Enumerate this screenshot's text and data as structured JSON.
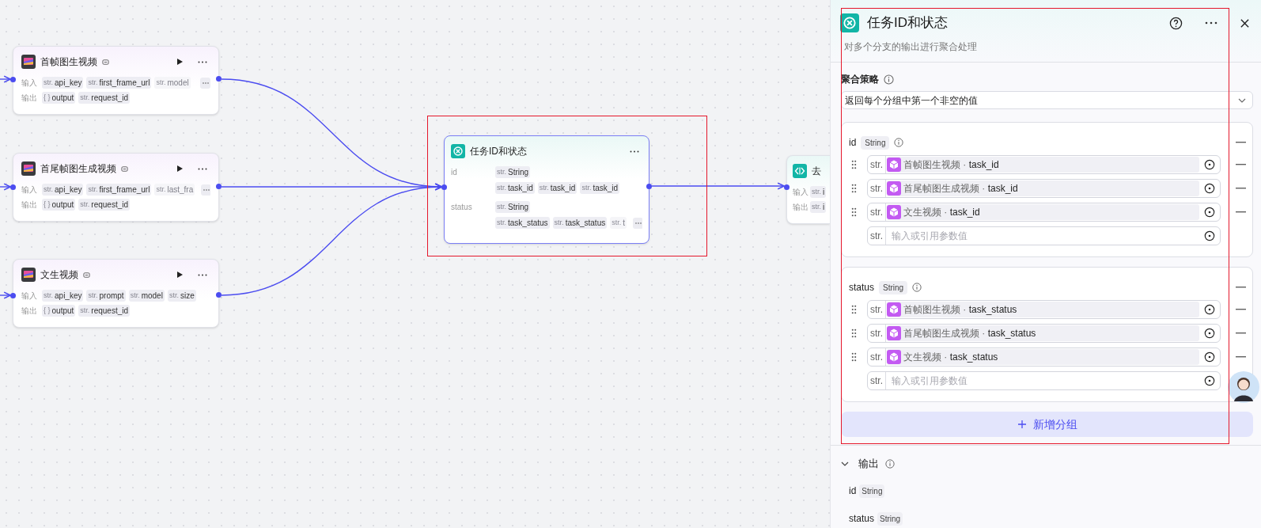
{
  "canvas": {
    "nodes": [
      {
        "kind": "video",
        "title": "首帧图生视频",
        "runnable": true,
        "rows": [
          {
            "label": "输入",
            "params": [
              {
                "type": "str.",
                "name": "api_key",
                "faded": false
              },
              {
                "type": "str.",
                "name": "first_frame_url",
                "faded": false
              },
              {
                "type": "str.",
                "name": "model",
                "faded": true
              }
            ],
            "overflow": true
          },
          {
            "label": "输出",
            "params": [
              {
                "type": "{ }",
                "name": "output",
                "faded": false
              },
              {
                "type": "str.",
                "name": "request_id",
                "faded": false
              }
            ],
            "overflow": false
          }
        ]
      },
      {
        "kind": "video",
        "title": "首尾帧图生成视频",
        "runnable": true,
        "rows": [
          {
            "label": "输入",
            "params": [
              {
                "type": "str.",
                "name": "api_key",
                "faded": false
              },
              {
                "type": "str.",
                "name": "first_frame_url",
                "faded": false
              },
              {
                "type": "str.",
                "name": "last_fra",
                "faded": true
              }
            ],
            "overflow": true
          },
          {
            "label": "输出",
            "params": [
              {
                "type": "{ }",
                "name": "output",
                "faded": false
              },
              {
                "type": "str.",
                "name": "request_id",
                "faded": false
              }
            ],
            "overflow": false
          }
        ]
      },
      {
        "kind": "video",
        "title": "文生视频",
        "runnable": true,
        "rows": [
          {
            "label": "输入",
            "params": [
              {
                "type": "str.",
                "name": "api_key",
                "faded": false
              },
              {
                "type": "str.",
                "name": "prompt",
                "faded": false
              },
              {
                "type": "str.",
                "name": "model",
                "faded": false
              },
              {
                "type": "str.",
                "name": "size",
                "faded": false
              }
            ],
            "overflow": false
          },
          {
            "label": "输出",
            "params": [
              {
                "type": "{ }",
                "name": "output",
                "faded": false
              },
              {
                "type": "str.",
                "name": "request_id",
                "faded": false
              }
            ],
            "overflow": false
          }
        ]
      },
      {
        "kind": "aggregate",
        "title": "任务ID和状态",
        "selected": true,
        "rows": [
          {
            "label": "id",
            "params": [
              {
                "type": "str.",
                "name": "String",
                "faded": false
              }
            ],
            "overflow": false
          },
          {
            "label": "",
            "params": [
              {
                "type": "str.",
                "name": "task_id",
                "faded": false
              },
              {
                "type": "str.",
                "name": "task_id",
                "faded": false
              },
              {
                "type": "str.",
                "name": "task_id",
                "faded": false
              }
            ],
            "overflow": false
          },
          {
            "label": "status",
            "params": [
              {
                "type": "str.",
                "name": "String",
                "faded": false
              }
            ],
            "overflow": false
          },
          {
            "label": "",
            "params": [
              {
                "type": "str.",
                "name": "task_status",
                "faded": false
              },
              {
                "type": "str.",
                "name": "task_status",
                "faded": false
              },
              {
                "type": "str.",
                "name": "t",
                "faded": true
              }
            ],
            "overflow": true
          }
        ]
      },
      {
        "kind": "code",
        "title": "去",
        "rows": [
          {
            "label": "输入",
            "params": [
              {
                "type": "str.",
                "name": "i"
              }
            ]
          },
          {
            "label": "输出",
            "params": [
              {
                "type": "str.",
                "name": "i"
              }
            ]
          }
        ]
      }
    ]
  },
  "panel": {
    "title": "任务ID和状态",
    "description": "对多个分支的输出进行聚合处理",
    "strategy_label": "聚合策略",
    "strategy_value": "返回每个分组中第一个非空的值",
    "groups": [
      {
        "name": "id",
        "type": "String",
        "items": [
          {
            "type": "str.",
            "ref": "首帧图生视频 · **task_id**"
          },
          {
            "type": "str.",
            "ref": "首尾帧图生成视频 · **task_id**"
          },
          {
            "type": "str.",
            "ref": "文生视频 · **task_id**"
          }
        ],
        "empty": {
          "type": "str.",
          "placeholder": "输入或引用参数值"
        }
      },
      {
        "name": "status",
        "type": "String",
        "items": [
          {
            "type": "str.",
            "ref": "首帧图生视频 · **task_status**"
          },
          {
            "type": "str.",
            "ref": "首尾帧图生成视频 · **task_status**"
          },
          {
            "type": "str.",
            "ref": "文生视频 · **task_status**"
          }
        ],
        "empty": {
          "type": "str.",
          "placeholder": "输入或引用参数值"
        }
      }
    ],
    "add_group": "新增分组",
    "output": {
      "label": "输出",
      "expanded": true,
      "fields": [
        {
          "name": "id",
          "type": "String"
        },
        {
          "name": "status",
          "type": "String"
        }
      ]
    }
  }
}
